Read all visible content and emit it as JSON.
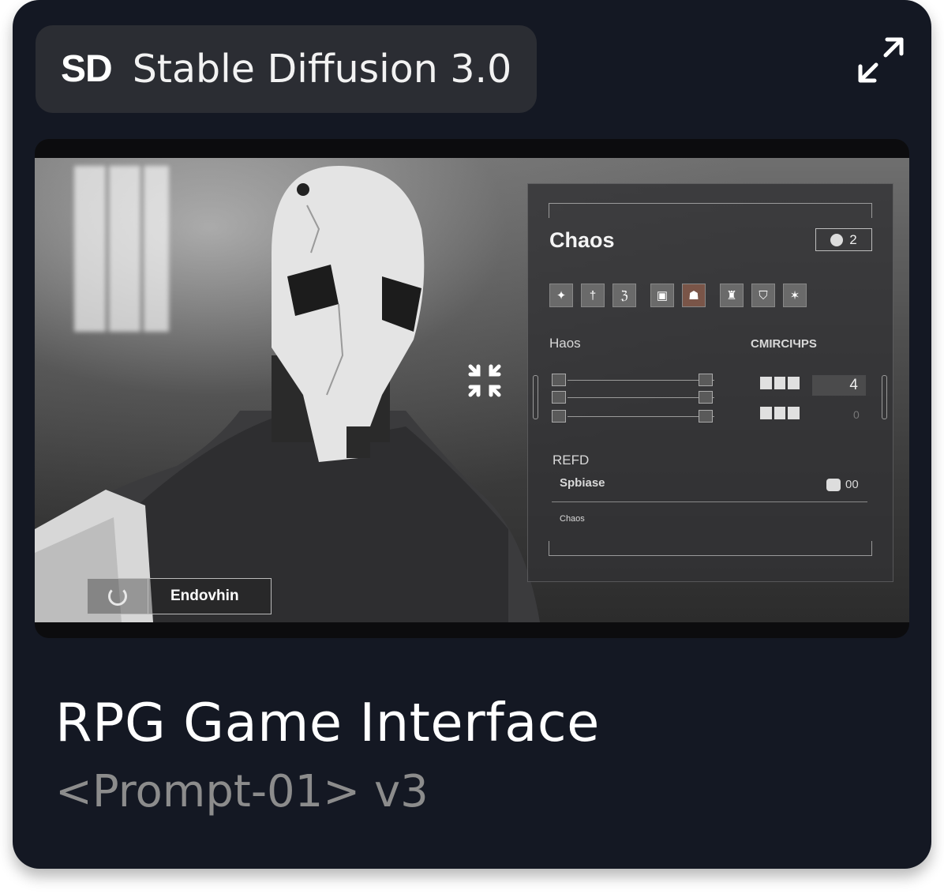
{
  "model": {
    "logo": "SD",
    "name": "Stable Diffusion 3.0"
  },
  "icons": {
    "expand": "expand-icon",
    "collapse": "collapse-icon",
    "refresh": "refresh-icon"
  },
  "preview": {
    "hud": {
      "title": "Chaos",
      "badge_count": "2",
      "stats_label": "Haos",
      "counters_label": "CMIRCIЧPS",
      "counter_value": "4",
      "counter_value_2": "0",
      "section_label": "REFD",
      "item_name": "Spbiase",
      "item_count": "00",
      "footer_label": "Chaos"
    },
    "character_name": "Endovhin"
  },
  "card": {
    "title": "RPG Game Interface",
    "subtitle": "<Prompt-01> v3"
  }
}
